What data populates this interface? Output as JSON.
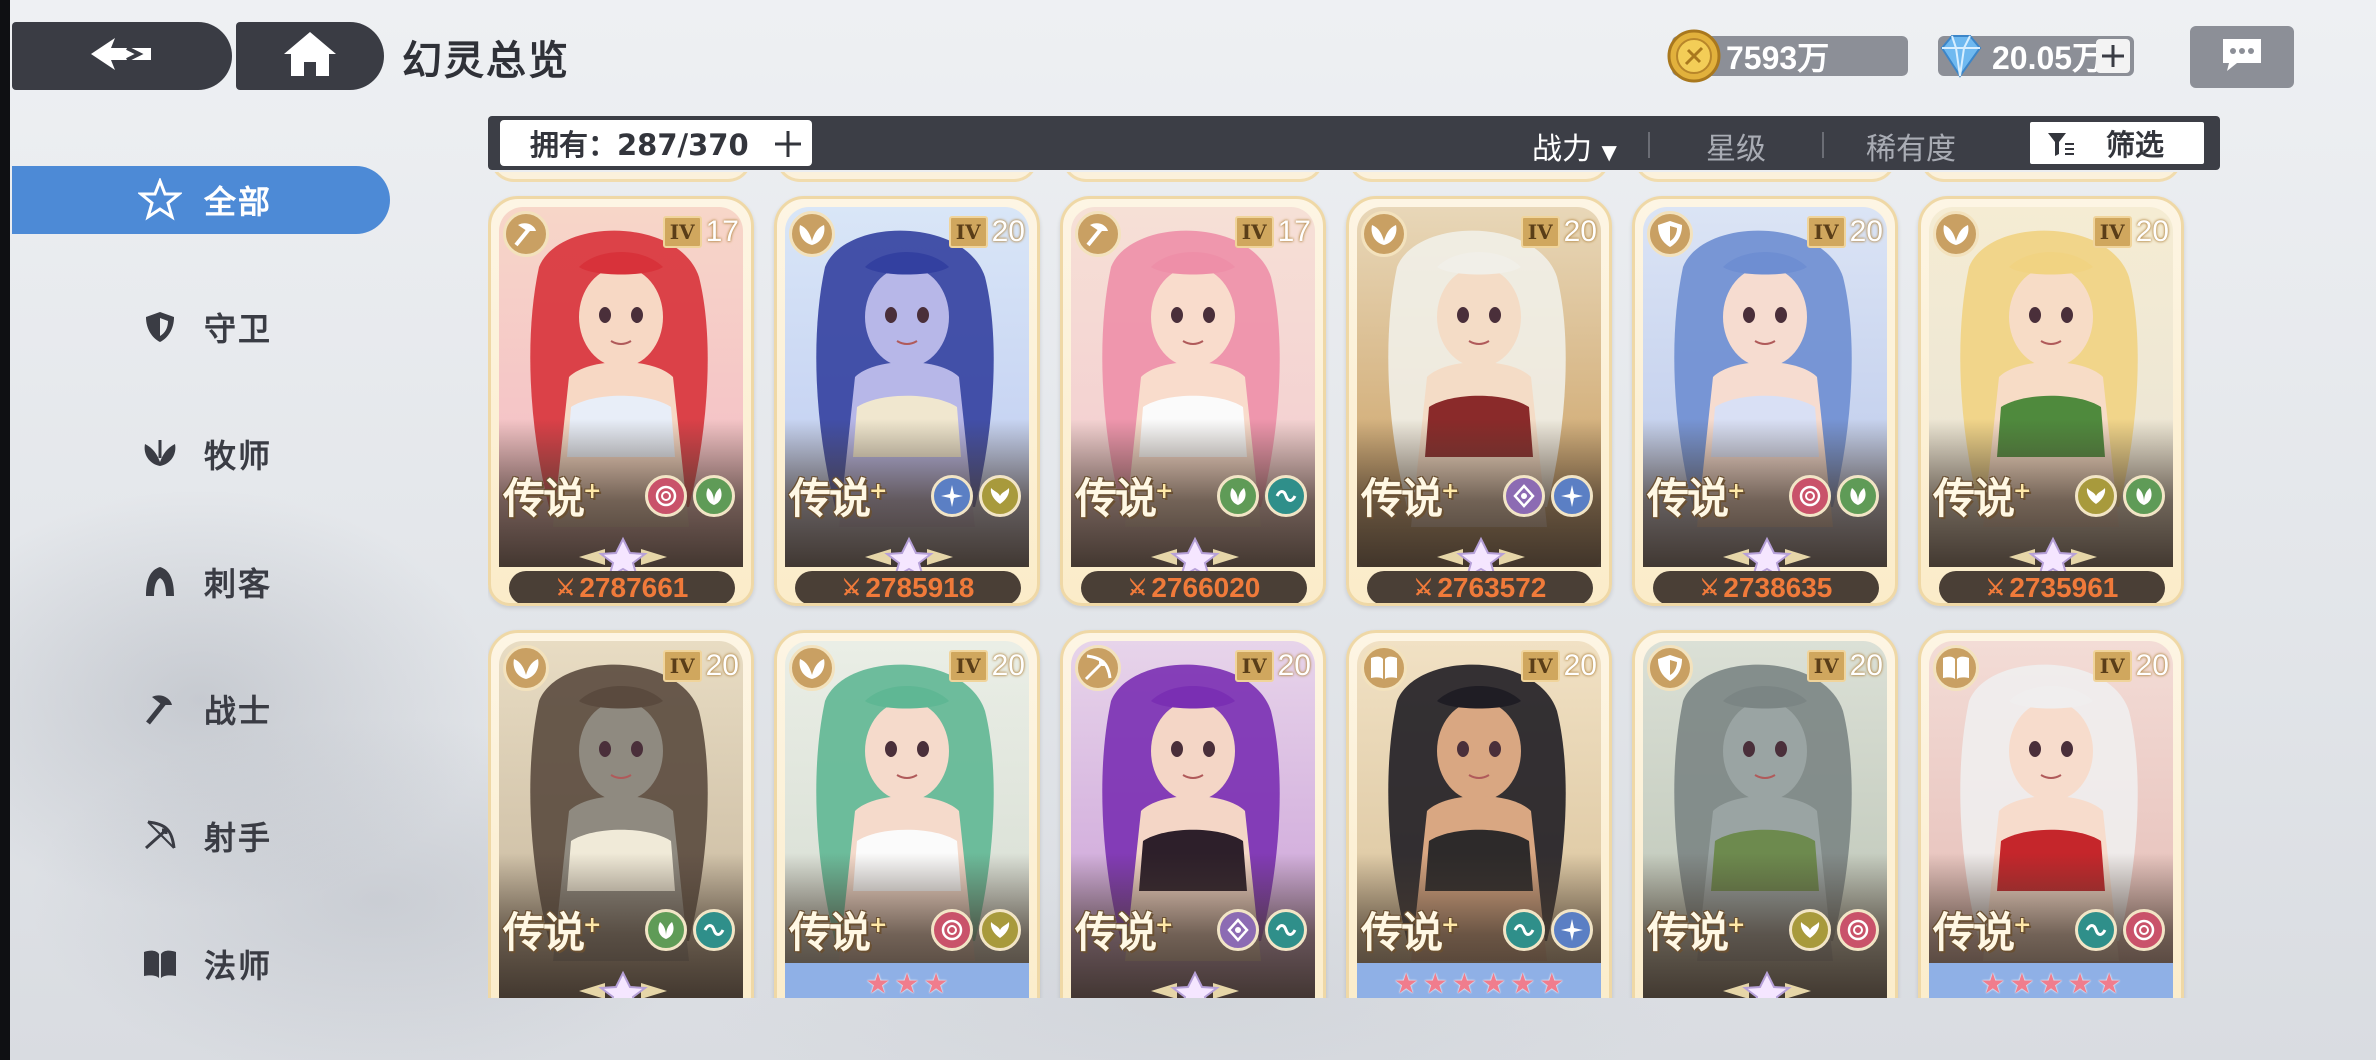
{
  "header": {
    "title": "幻灵总览",
    "coins": "7593万",
    "gems": "20.05万"
  },
  "sidebar": {
    "items": [
      {
        "label": "全部",
        "icon": "star-outline-icon",
        "active": true
      },
      {
        "label": "守卫",
        "icon": "shield-icon",
        "active": false
      },
      {
        "label": "牧师",
        "icon": "leaf-heal-icon",
        "active": false
      },
      {
        "label": "刺客",
        "icon": "hood-icon",
        "active": false
      },
      {
        "label": "战士",
        "icon": "axe-icon",
        "active": false
      },
      {
        "label": "射手",
        "icon": "bow-icon",
        "active": false
      },
      {
        "label": "法师",
        "icon": "book-icon",
        "active": false
      }
    ]
  },
  "filter_bar": {
    "owned_label": "拥有：287/370",
    "sort_power": "战力",
    "sort_star": "星级",
    "sort_rarity": "稀有度",
    "filter_label": "筛选"
  },
  "cards": [
    {
      "class_icon": "axe-icon",
      "tier": "IV",
      "level": "17",
      "rarity": "传说",
      "elements": [
        "swirl",
        "leaf"
      ],
      "power": "2787661",
      "art": "red-haired-warrior"
    },
    {
      "class_icon": "leaf-heal-icon",
      "tier": "IV",
      "level": "20",
      "rarity": "传说",
      "elements": [
        "frost",
        "wing"
      ],
      "power": "2785918",
      "art": "blue-haired-priestess"
    },
    {
      "class_icon": "axe-icon",
      "tier": "IV",
      "level": "17",
      "rarity": "传说",
      "elements": [
        "leaf",
        "wave"
      ],
      "power": "2766020",
      "art": "pink-haired-cow-girl"
    },
    {
      "class_icon": "leaf-heal-icon",
      "tier": "IV",
      "level": "20",
      "rarity": "传说",
      "elements": [
        "diamond",
        "frost"
      ],
      "power": "2763572",
      "art": "white-haired-knight"
    },
    {
      "class_icon": "shield-icon",
      "tier": "IV",
      "level": "20",
      "rarity": "传说",
      "elements": [
        "swirl",
        "leaf"
      ],
      "power": "2738635",
      "art": "blue-haired-horned"
    },
    {
      "class_icon": "leaf-heal-icon",
      "tier": "IV",
      "level": "20",
      "rarity": "传说",
      "elements": [
        "wing",
        "leaf"
      ],
      "power": "2735961",
      "art": "blonde-angel"
    },
    {
      "class_icon": "leaf-heal-icon",
      "tier": "IV",
      "level": "20",
      "rarity": "传说",
      "elements": [
        "leaf",
        "wave"
      ],
      "power": "",
      "art": "boar-warrior"
    },
    {
      "class_icon": "leaf-heal-icon",
      "tier": "IV",
      "level": "20",
      "rarity": "传说",
      "elements": [
        "swirl",
        "wing"
      ],
      "power": "",
      "art": "green-haired-archer",
      "stars": 3
    },
    {
      "class_icon": "bow-icon",
      "tier": "IV",
      "level": "20",
      "rarity": "传说",
      "elements": [
        "diamond",
        "wave"
      ],
      "power": "",
      "art": "purple-haired-sorceress"
    },
    {
      "class_icon": "book-icon",
      "tier": "IV",
      "level": "20",
      "rarity": "传说",
      "elements": [
        "wave",
        "frost"
      ],
      "power": "",
      "art": "cat-eared-dancer",
      "stars": 6
    },
    {
      "class_icon": "shield-icon",
      "tier": "IV",
      "level": "20",
      "rarity": "传说",
      "elements": [
        "wing",
        "swirl"
      ],
      "power": "",
      "art": "stone-golem"
    },
    {
      "class_icon": "book-icon",
      "tier": "IV",
      "level": "20",
      "rarity": "传说",
      "elements": [
        "wave",
        "swirl"
      ],
      "power": "",
      "art": "white-haired-fox",
      "stars": 5
    }
  ],
  "colors": {
    "accent": "#4d8ad6",
    "dark_bar": "#3c3e46",
    "power_text": "#f07a3a",
    "card_bg": "#fbecc9"
  }
}
